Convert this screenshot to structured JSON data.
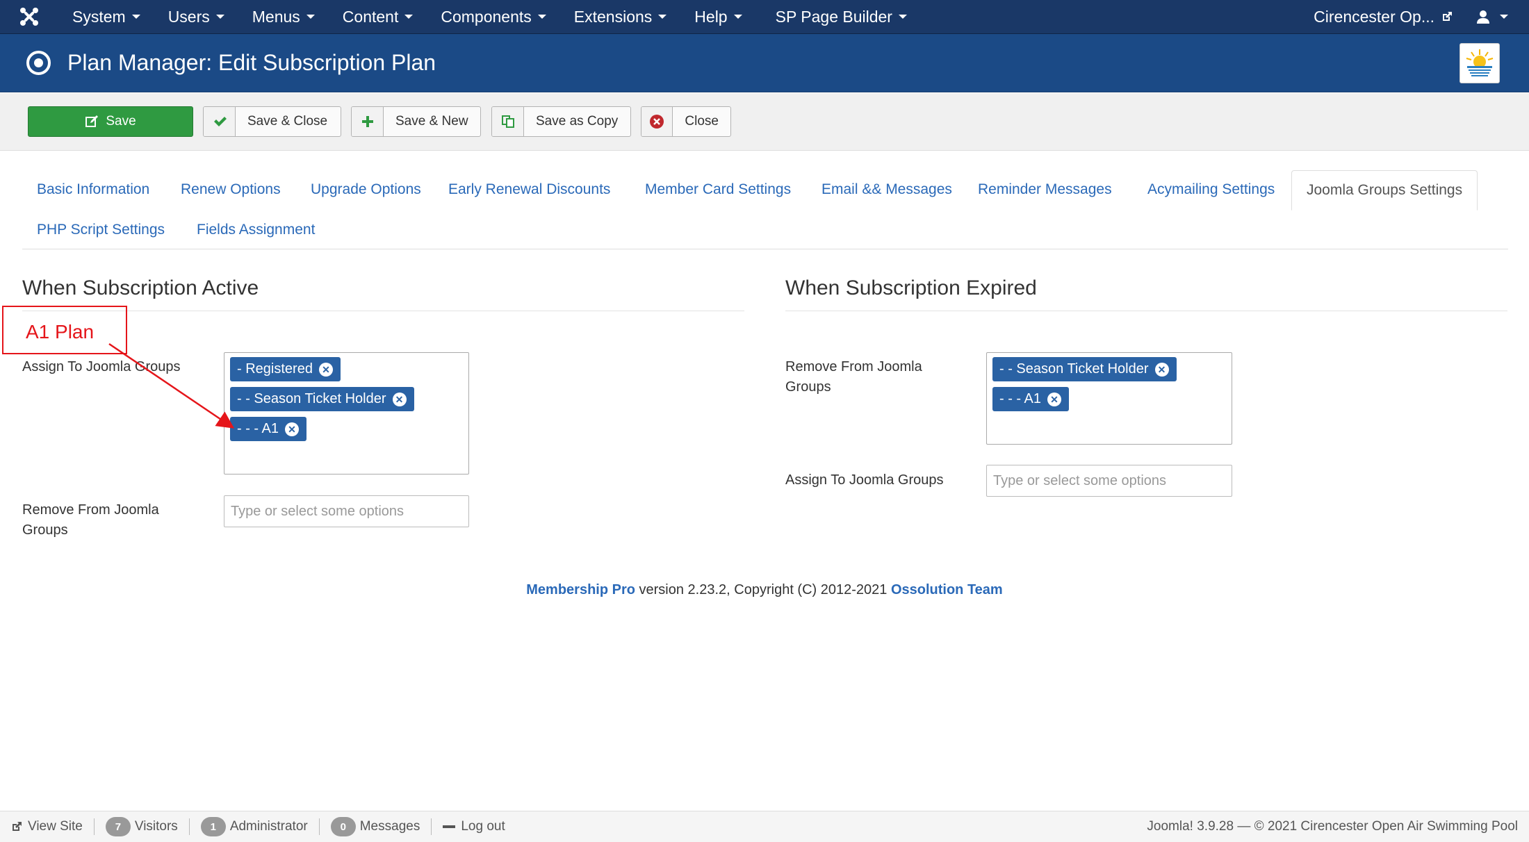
{
  "navbar": {
    "logo_icon": "joomla-icon",
    "menus": [
      "System",
      "Users",
      "Menus",
      "Content",
      "Components",
      "Extensions",
      "Help",
      "SP Page Builder"
    ],
    "site_name": "Cirencester Op...",
    "user_icon": "user-icon"
  },
  "header": {
    "title": "Plan Manager: Edit Subscription Plan"
  },
  "toolbar": {
    "save": "Save",
    "save_close": "Save & Close",
    "save_new": "Save & New",
    "save_copy": "Save as Copy",
    "close": "Close"
  },
  "tabs": {
    "items": [
      "Basic Information",
      "Renew Options",
      "Upgrade Options",
      "Early Renewal Discounts",
      "Member Card Settings",
      "Email && Messages",
      "Reminder Messages",
      "Acymailing Settings",
      "Joomla Groups Settings",
      "PHP Script Settings",
      "Fields Assignment"
    ],
    "active": "Joomla Groups Settings"
  },
  "active_section": {
    "title": "When Subscription Active",
    "assign_label": "Assign To Joomla Groups",
    "assign_chips": [
      "- Registered",
      "- - Season Ticket Holder",
      "- - - A1"
    ],
    "remove_label": "Remove From Joomla Groups",
    "remove_placeholder": "Type or select some options"
  },
  "expired_section": {
    "title": "When Subscription Expired",
    "remove_label": "Remove From Joomla Groups",
    "remove_chips": [
      "- - Season Ticket Holder",
      "- - - A1"
    ],
    "assign_label": "Assign To Joomla Groups",
    "assign_placeholder": "Type or select some options"
  },
  "annotation": {
    "text": "A1 Plan",
    "color": "#e5151a"
  },
  "copyright": {
    "product": "Membership Pro",
    "middle": " version 2.23.2, Copyright (C) 2012-2021 ",
    "team": "Ossolution Team"
  },
  "statusbar": {
    "view_site": "View Site",
    "visitors_count": "7",
    "visitors": "Visitors",
    "admin_count": "1",
    "admin": "Administrator",
    "messages_count": "0",
    "messages": "Messages",
    "logout": "Log out",
    "right": "Joomla! 3.9.28 — © 2021 Cirencester Open Air Swimming Pool"
  },
  "colors": {
    "navbar": "#1a3867",
    "header": "#1b4a86",
    "save_button": "#2f9a41",
    "chip": "#2a62a4",
    "link": "#2a69b8"
  }
}
